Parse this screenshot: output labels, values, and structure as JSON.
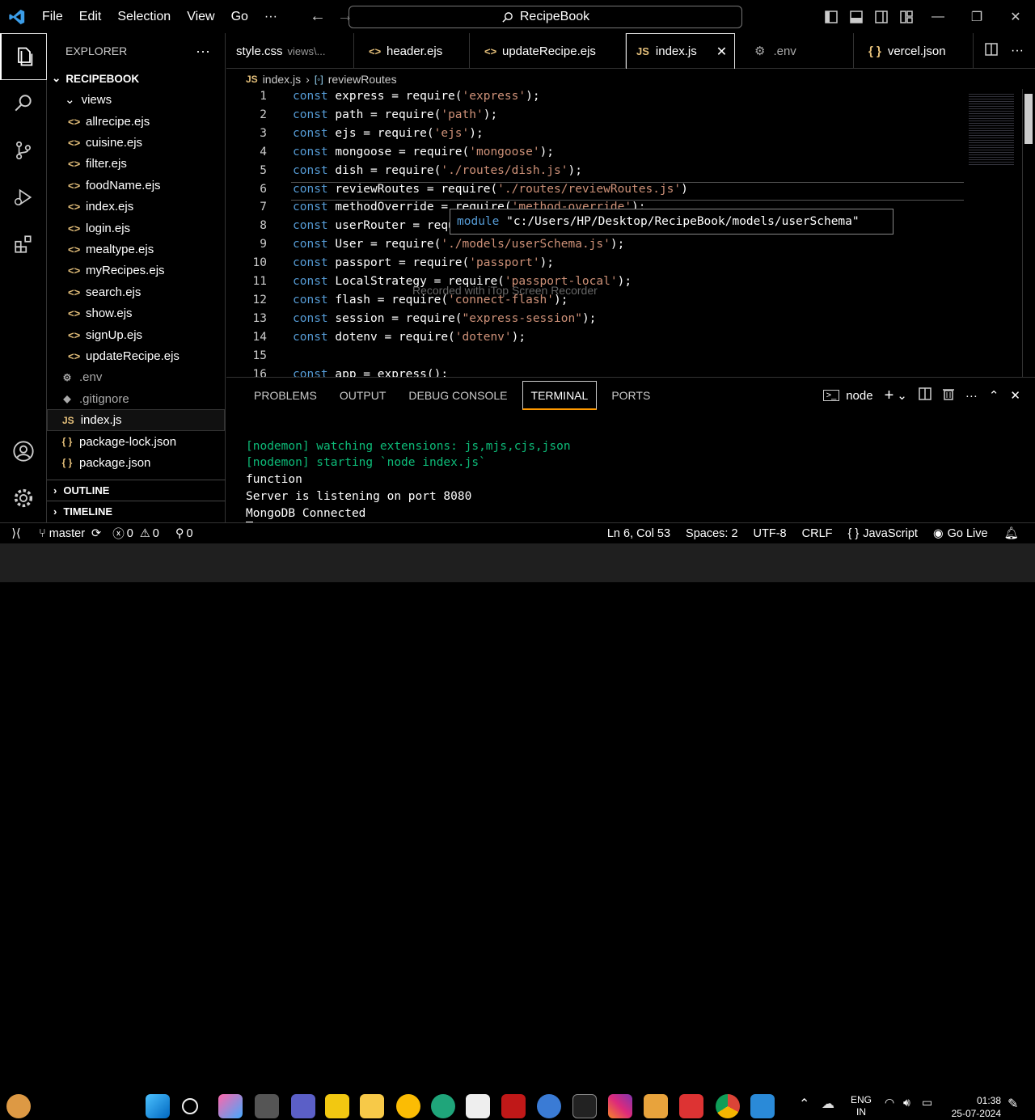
{
  "titlebar": {
    "menu": [
      "File",
      "Edit",
      "Selection",
      "View",
      "Go",
      "···"
    ],
    "search": "RecipeBook"
  },
  "explorer": {
    "title": "EXPLORER",
    "more": "···",
    "root": "RECIPEBOOK",
    "folder": "views",
    "files": [
      "allrecipe.ejs",
      "cuisine.ejs",
      "filter.ejs",
      "foodName.ejs",
      "index.ejs",
      "login.ejs",
      "mealtype.ejs",
      "myRecipes.ejs",
      "search.ejs",
      "show.ejs",
      "signUp.ejs",
      "updateRecipe.ejs"
    ],
    "root_files": [
      {
        "name": ".env",
        "icon": "⚙",
        "muted": true
      },
      {
        "name": ".gitignore",
        "icon": "◆",
        "muted": true
      },
      {
        "name": "index.js",
        "icon": "JS",
        "muted": false,
        "selected": true
      },
      {
        "name": "package-lock.json",
        "icon": "{ }",
        "muted": false
      },
      {
        "name": "package.json",
        "icon": "{ }",
        "muted": false
      }
    ],
    "outline": "OUTLINE",
    "timeline": "TIMELINE"
  },
  "tabs": [
    {
      "name": "style.css",
      "desc": "views\\...",
      "icon": "#"
    },
    {
      "name": "header.ejs",
      "icon": "<>"
    },
    {
      "name": "updateRecipe.ejs",
      "icon": "<>"
    },
    {
      "name": "index.js",
      "icon": "JS",
      "active": true
    },
    {
      "name": ".env",
      "icon": "⚙"
    },
    {
      "name": "vercel.json",
      "icon": "{ }"
    }
  ],
  "breadcrumb": {
    "file": "index.js",
    "symbol": "reviewRoutes"
  },
  "code": [
    {
      "n": "1",
      "t": "const express = require('express');"
    },
    {
      "n": "2",
      "t": "const path = require('path');"
    },
    {
      "n": "3",
      "t": "const ejs = require('ejs');"
    },
    {
      "n": "4",
      "t": "const mongoose = require('mongoose');"
    },
    {
      "n": "5",
      "t": "const dish = require('./routes/dish.js');"
    },
    {
      "n": "6",
      "t": "const reviewRoutes = require('./routes/reviewRoutes.js')"
    },
    {
      "n": "7",
      "t": "const methodOverride = require('method-override');"
    },
    {
      "n": "8",
      "t": "const userRouter = require('./routes/user.js');"
    },
    {
      "n": "9",
      "t": "const User = require('./models/userSchema.js');"
    },
    {
      "n": "10",
      "t": "const passport = require('passport');"
    },
    {
      "n": "11",
      "t": "const LocalStrategy = require('passport-local');"
    },
    {
      "n": "12",
      "t": "const flash = require('connect-flash');"
    },
    {
      "n": "13",
      "t": "const session = require(\"express-session\");"
    },
    {
      "n": "14",
      "t": "const dotenv = require('dotenv');"
    },
    {
      "n": "15",
      "t": ""
    },
    {
      "n": "16",
      "t": "const app = express();"
    }
  ],
  "hover": {
    "label": "module",
    "path": "\"c:/Users/HP/Desktop/RecipeBook/models/userSchema\""
  },
  "watermark": "Recorded with iTop Screen Recorder",
  "panel": {
    "tabs": [
      "PROBLEMS",
      "OUTPUT",
      "DEBUG CONSOLE",
      "TERMINAL",
      "PORTS"
    ],
    "active": "TERMINAL",
    "shell": "node",
    "terminal": [
      "[nodemon] watching extensions: js,mjs,cjs,json",
      "[nodemon] starting `node index.js`",
      "function",
      "Server is listening on port 8080",
      "MongoDB Connected"
    ]
  },
  "status": {
    "branch": "master",
    "errors": "0",
    "warnings": "0",
    "ports": "0",
    "position": "Ln 6, Col 53",
    "spaces": "Spaces: 2",
    "encoding": "UTF-8",
    "eol": "CRLF",
    "language": "JavaScript",
    "golive": "Go Live"
  },
  "taskbar": {
    "lang1": "ENG",
    "lang2": "IN",
    "time": "01:38",
    "date": "25-07-2024"
  }
}
